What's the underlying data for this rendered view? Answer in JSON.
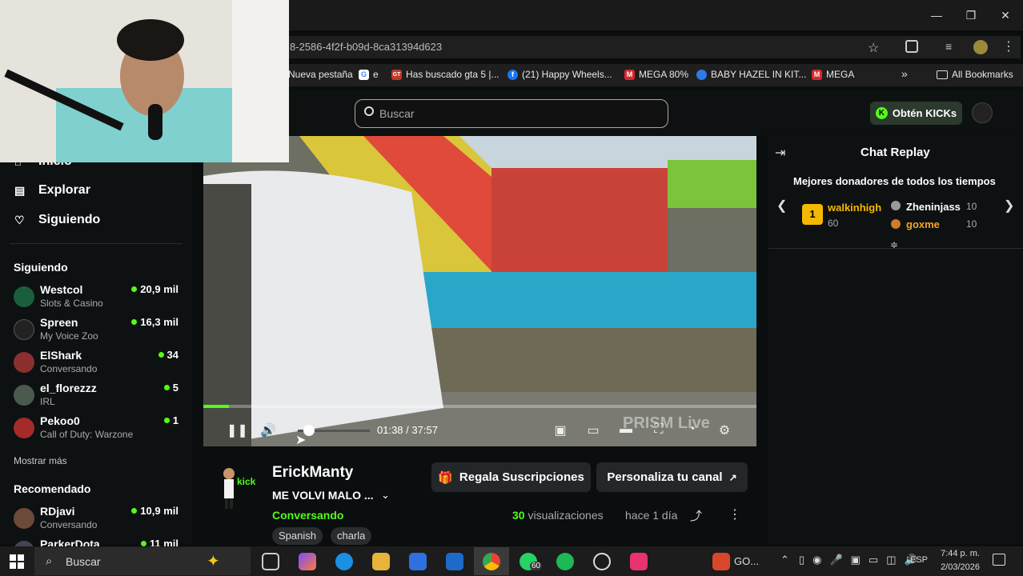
{
  "browser": {
    "url": "8-2586-4f2f-b09d-8ca31394d623",
    "bookmarks": [
      {
        "label": "Nueva pestaña",
        "color": "#444",
        "glyph": ""
      },
      {
        "label": "e",
        "color": "#4285f4",
        "glyph": "G"
      },
      {
        "label": "Has buscado gta 5 |...",
        "color": "#c0392b",
        "glyph": "GT"
      },
      {
        "label": "(21) Happy Wheels...",
        "color": "#1877f2",
        "glyph": "f"
      },
      {
        "label": "MEGA 80%",
        "color": "#d9272e",
        "glyph": "M"
      },
      {
        "label": "BABY HAZEL IN KIT...",
        "color": "#2c7be5",
        "glyph": "●"
      },
      {
        "label": "MEGA",
        "color": "#d9272e",
        "glyph": "M"
      }
    ],
    "all_bookmarks": "All Bookmarks"
  },
  "header": {
    "search_placeholder": "Buscar",
    "kicks_button": "Obtén KICKs"
  },
  "sidebar": {
    "nav": [
      {
        "label": "Inicio"
      },
      {
        "label": "Explorar"
      },
      {
        "label": "Siguiendo"
      }
    ],
    "following_title": "Siguiendo",
    "following": [
      {
        "name": "Westcol",
        "category": "Slots & Casino",
        "viewers": "20,9 mil",
        "color": "#1b5e3b"
      },
      {
        "name": "Spreen",
        "category": "My Voice Zoo",
        "viewers": "16,3 mil",
        "color": "#222"
      },
      {
        "name": "ElShark",
        "category": "Conversando",
        "viewers": "34",
        "color": "#8b2f2f"
      },
      {
        "name": "el_florezzz",
        "category": "IRL",
        "viewers": "5",
        "color": "#4a5a4f"
      },
      {
        "name": "Pekoo0",
        "category": "Call of Duty: Warzone",
        "viewers": "1",
        "color": "#a52a2a"
      }
    ],
    "show_more": "Mostrar más",
    "recommended_title": "Recomendado",
    "recommended": [
      {
        "name": "RDjavi",
        "category": "Conversando",
        "viewers": "10,9 mil",
        "color": "#6b4a3a"
      },
      {
        "name": "ParkerDota",
        "category": "",
        "viewers": "11 mil",
        "color": "#445"
      }
    ]
  },
  "player": {
    "current": "01:38",
    "duration": "37:57",
    "progress": 0.043,
    "watermark": "PRISM Live"
  },
  "chat": {
    "title": "Chat Replay",
    "donors_title": "Mejores donadores de todos los tiempos",
    "donors": [
      {
        "rank": "1",
        "name": "walkinhigh",
        "amount": "60"
      },
      {
        "name": "Zheninjass",
        "amount": "10"
      },
      {
        "name": "goxme",
        "amount": "10"
      }
    ]
  },
  "stream": {
    "streamer": "ErickManty",
    "title": "ME VOLVI MALO ...",
    "status": "Conversando",
    "tags": [
      "Spanish",
      "charla"
    ],
    "gift_button": "Regala Suscripciones",
    "customize_button": "Personaliza tu canal",
    "views_count": "30",
    "views_label": "visualizaciones",
    "ago": "hace 1 día",
    "logo_text": "kick"
  },
  "taskbar": {
    "search": "Buscar",
    "app_label": "GO...",
    "lang": "ESP",
    "time": "7:44 p. m.",
    "date": "2/03/2026",
    "badge": "60"
  }
}
